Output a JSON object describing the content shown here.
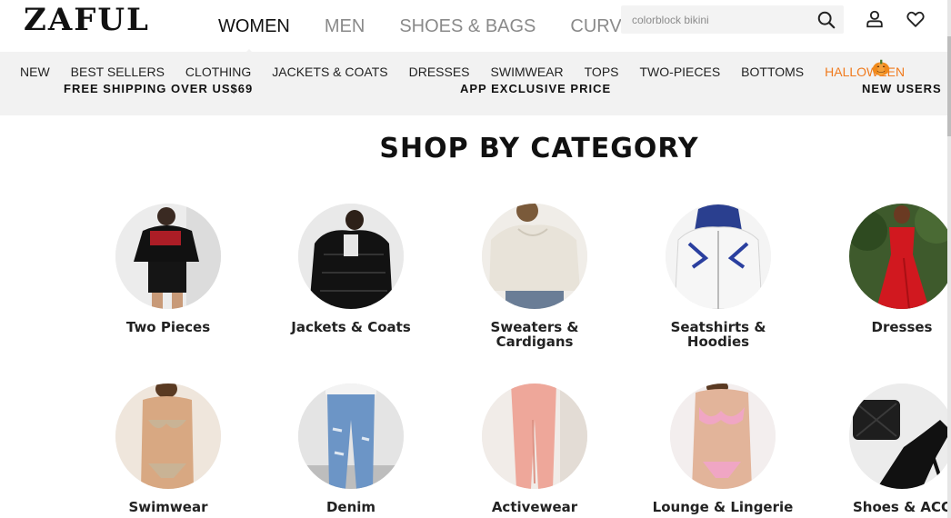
{
  "brand": {
    "logo_text": "ZAFUL"
  },
  "main_nav": [
    {
      "label": "WOMEN",
      "active": true
    },
    {
      "label": "MEN"
    },
    {
      "label": "SHOES & BAGS"
    },
    {
      "label": "CURVE"
    }
  ],
  "search": {
    "placeholder": "colorblock bikini"
  },
  "sub_nav": [
    {
      "label": "NEW"
    },
    {
      "label": "BEST SELLERS"
    },
    {
      "label": "CLOTHING"
    },
    {
      "label": "JACKETS & COATS"
    },
    {
      "label": "DRESSES"
    },
    {
      "label": "SWIMWEAR"
    },
    {
      "label": "TOPS"
    },
    {
      "label": "TWO-PIECES"
    },
    {
      "label": "BOTTOMS"
    },
    {
      "label": "HALLOWEEN"
    }
  ],
  "promos": [
    "FREE SHIPPING OVER US$69",
    "APP EXCLUSIVE PRICE",
    "NEW USERS"
  ],
  "section_title": "SHOP BY CATEGORY",
  "categories": [
    {
      "label": "Two Pieces"
    },
    {
      "label": "Jackets & Coats"
    },
    {
      "label": "Sweaters &\nCardigans"
    },
    {
      "label": "Seatshirts &\nHoodies"
    },
    {
      "label": "Dresses"
    },
    {
      "label": "Swimwear"
    },
    {
      "label": "Denim"
    },
    {
      "label": "Activewear"
    },
    {
      "label": "Lounge & Lingerie"
    },
    {
      "label": "Shoes & ACC"
    }
  ],
  "colors": {
    "halloween": "#f07a1d",
    "subnav_bg": "#f2f2f2",
    "inactive_nav": "#8a8a8a"
  },
  "icons": [
    "search-icon",
    "user-icon",
    "heart-icon",
    "pumpkin-icon"
  ]
}
